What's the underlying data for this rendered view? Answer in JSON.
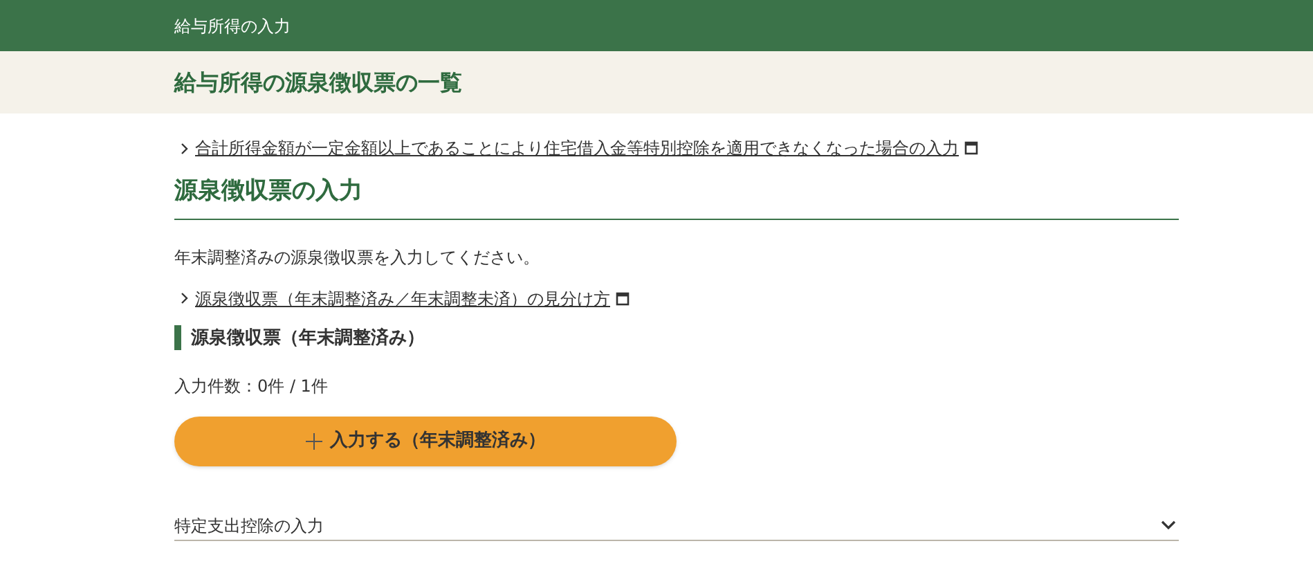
{
  "header": {
    "title": "給与所得の入力"
  },
  "page_title": "給与所得の源泉徴収票の一覧",
  "top_link": "合計所得金額が一定金額以上であることにより住宅借入金等特別控除を適用できなくなった場合の入力",
  "section": {
    "heading": "源泉徴収票の入力",
    "description": "年末調整済みの源泉徴収票を入力してください。",
    "link": "源泉徴収票（年末調整済み／年末調整未済）の見分け方",
    "subheading": "源泉徴収票（年末調整済み）",
    "count": "入力件数：0件 / 1件",
    "add_button": "入力する（年末調整済み）"
  },
  "accordion": {
    "label": "特定支出控除の入力",
    "expanded": false
  }
}
